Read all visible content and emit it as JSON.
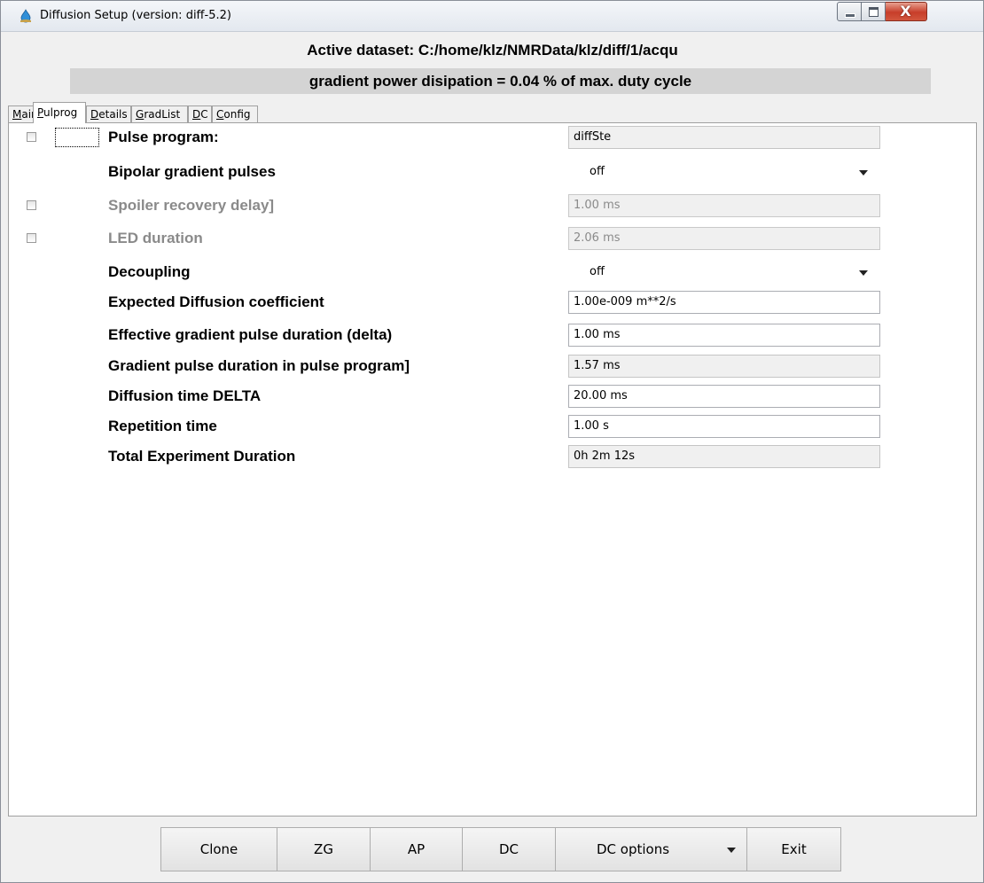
{
  "window": {
    "title": "Diffusion Setup (version: diff-5.2)",
    "close_glyph": "X"
  },
  "header": {
    "dataset": "Active dataset: C:/home/klz/NMRData/klz/diff/1/acqu",
    "power": "gradient power disipation = 0.04 % of max. duty cycle"
  },
  "tabs": [
    {
      "pre": "",
      "u": "M",
      "post": "ain"
    },
    {
      "pre": "",
      "u": "P",
      "post": "ulprog"
    },
    {
      "pre": "",
      "u": "D",
      "post": "etails"
    },
    {
      "pre": "",
      "u": "G",
      "post": "radList"
    },
    {
      "pre": "",
      "u": "D",
      "post": "C"
    },
    {
      "pre": "",
      "u": "C",
      "post": "onfig"
    }
  ],
  "active_tab": "Pulprog",
  "params": [
    {
      "label": "Pulse program:",
      "value": "diffSte",
      "kind": "readonly",
      "checkbox": true,
      "disabled": false
    },
    {
      "label": "Bipolar gradient pulses",
      "value": "off",
      "kind": "combo",
      "checkbox": false,
      "disabled": false
    },
    {
      "label": "Spoiler recovery delay]",
      "value": "1.00 ms",
      "kind": "readonly",
      "checkbox": true,
      "disabled": true
    },
    {
      "label": "LED duration",
      "value": "2.06 ms",
      "kind": "readonly",
      "checkbox": true,
      "disabled": true
    },
    {
      "label": "Decoupling",
      "value": "off",
      "kind": "combo",
      "checkbox": false,
      "disabled": false
    },
    {
      "label": "Expected Diffusion coefficient",
      "value": "1.00e-009 m**2/s",
      "kind": "editable",
      "checkbox": false,
      "disabled": false
    },
    {
      "label": "Effective gradient pulse duration (delta)",
      "value": "1.00 ms",
      "kind": "editable",
      "checkbox": false,
      "disabled": false
    },
    {
      "label": "Gradient pulse duration in pulse program]",
      "value": "1.57 ms",
      "kind": "readonly",
      "checkbox": false,
      "disabled": false
    },
    {
      "label": "Diffusion time DELTA",
      "value": "20.00 ms",
      "kind": "editable",
      "checkbox": false,
      "disabled": false
    },
    {
      "label": "Repetition time",
      "value": "1.00 s",
      "kind": "editable",
      "checkbox": false,
      "disabled": false
    },
    {
      "label": "Total Experiment Duration",
      "value": "0h 2m 12s",
      "kind": "readonly",
      "checkbox": false,
      "disabled": false
    }
  ],
  "buttons": {
    "clone": "Clone",
    "zg": "ZG",
    "ap": "AP",
    "dc": "DC",
    "dc_options": "DC options",
    "exit": "Exit"
  },
  "icons": {
    "app": "water-drop-icon",
    "minimize": "minimize-icon",
    "maximize": "maximize-icon",
    "close": "close-icon",
    "dropdown": "chevron-down-icon"
  },
  "colors": {
    "close_button": "#c73e2a",
    "power_bar": "#d4d4d4",
    "app_icon": "#2f8fd8"
  }
}
